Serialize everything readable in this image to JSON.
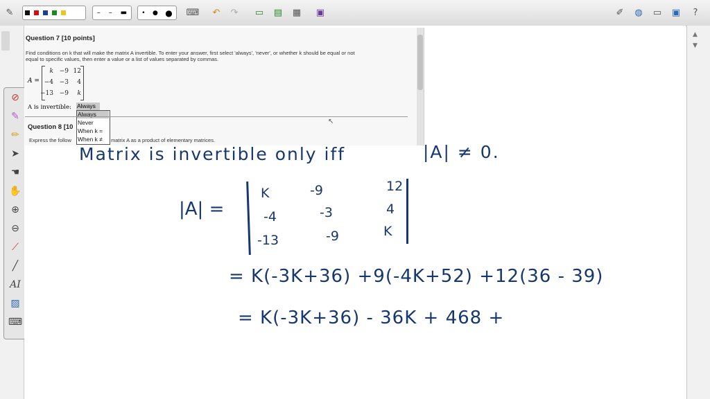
{
  "toolbar": {
    "colors": [
      "#111111",
      "#d01010",
      "#1d3f8f",
      "#1a8a1a",
      "#e8c61a"
    ],
    "icons": [
      "pen-icon",
      "dash-line-icon",
      "dot-size-icon",
      "keyboard-icon",
      "undo-icon",
      "redo-icon",
      "new-page-icon",
      "insert-icon",
      "document-icon",
      "screen-capture-icon",
      "edit-icon",
      "globe-icon",
      "folder-icon",
      "monitor-icon",
      "help-icon"
    ]
  },
  "palette": {
    "tools": [
      "eraser-icon",
      "highlighter-icon",
      "pen-icon",
      "pointer-icon",
      "hand-icon",
      "zoom-in-icon",
      "zoom-out-icon",
      "dropper-icon",
      "line-icon",
      "text-icon",
      "image-icon",
      "keyboard-icon"
    ],
    "text_tool_label": "AI"
  },
  "question": {
    "title": "Question 7 [10 points]",
    "prompt_line1": "Find conditions on k that will make the matrix A invertible. To enter your answer, first select 'always', 'never', or whether k should be equal or not",
    "prompt_line2": "equal to specific values, then enter a value or a list of values separated by commas.",
    "matrix_label": "A =",
    "matrix": [
      [
        "k",
        "−9",
        "12"
      ],
      [
        "−4",
        "−3",
        "4"
      ],
      [
        "−13",
        "−9",
        "k"
      ]
    ],
    "invertible_label": "A is invertible:",
    "selected_option": "Always",
    "options": [
      "Always",
      "Never",
      "When k =",
      "When k ≠"
    ],
    "next_title": "Question 8 [10",
    "next_text_left": "Express the follow",
    "next_text_right": "matrix A as a product of elementary matrices."
  },
  "handwriting": {
    "line1_text": "Matrix  is  invertible   only  iff",
    "line1_condition": "|A| ≠ 0.",
    "det_label": "|A| =",
    "det_matrix": [
      [
        "K",
        "-9",
        "12"
      ],
      [
        "-4",
        "-3",
        "4"
      ],
      [
        "-13",
        "-9",
        "K"
      ]
    ],
    "expansion_line1": "= K(-3K+36) +9(-4K+52) +12(36 - 39)",
    "expansion_line2": "= K(-3K+36) - 36K + 468 +"
  }
}
